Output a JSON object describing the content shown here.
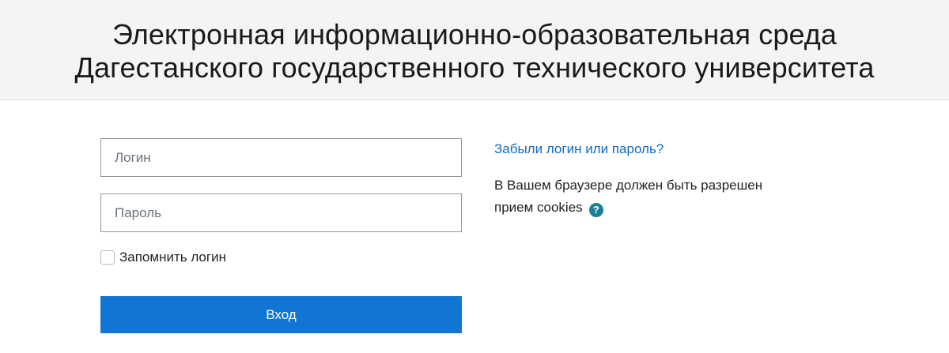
{
  "header": {
    "title_line1": "Электронная информационно-образовательная среда",
    "title_line2": "Дагестанского государственного технического университета"
  },
  "login_form": {
    "username_placeholder": "Логин",
    "username_value": "",
    "password_placeholder": "Пароль",
    "password_value": "",
    "remember_label": "Запомнить логин",
    "remember_checked": false,
    "login_button_label": "Вход"
  },
  "info": {
    "forgot_link": "Забыли логин или пароль?",
    "cookies_line1": "В Вашем браузере должен быть разрешен",
    "cookies_line2": "прием cookies",
    "help_icon_glyph": "?",
    "help_icon": "question-circle-icon"
  },
  "colors": {
    "header_bg": "#f4f4f4",
    "button_bg": "#1176d3",
    "link": "#0f6cbf",
    "help_icon_bg": "#1a7f97"
  }
}
